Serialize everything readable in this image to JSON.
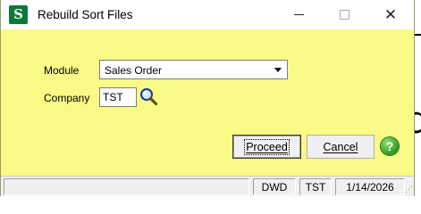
{
  "window": {
    "title": "Rebuild Sort Files",
    "app_icon_letter": "S",
    "close_glyph": "✕"
  },
  "form": {
    "module_label": "Module",
    "module_value": "Sales Order",
    "company_label": "Company",
    "company_value": "TST"
  },
  "buttons": {
    "proceed_label": "Proceed",
    "cancel_label": "Cancel",
    "help_glyph": "?"
  },
  "statusbar": {
    "user": "DWD",
    "company": "TST",
    "date": "1/14/2026"
  },
  "background": {
    "glyph": "d"
  },
  "colors": {
    "window_background": "#fafa86",
    "app_icon": "#0a7a3a",
    "help_icon": "#2d9a1e"
  }
}
